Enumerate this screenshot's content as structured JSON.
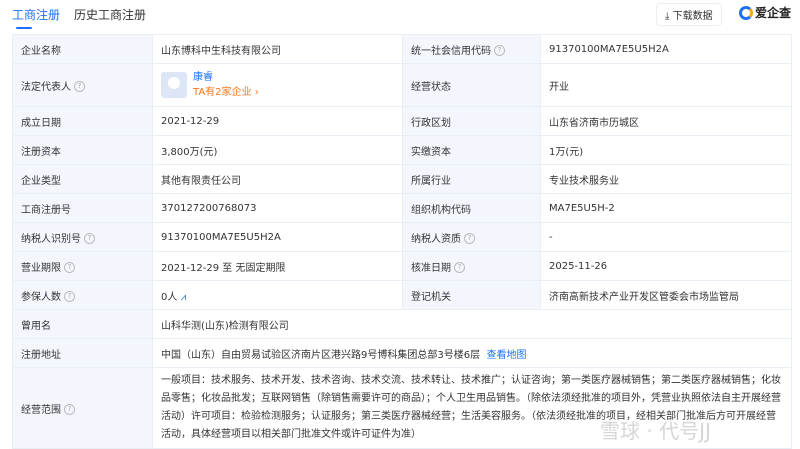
{
  "tabs": [
    "工商注册",
    "历史工商注册"
  ],
  "download": "下载数据",
  "logo": "爱企查",
  "watermark": "雪球 · 代号JJ",
  "rows": {
    "name_l": "企业名称",
    "name_v": "山东博科中生科技有限公司",
    "credit_l": "统一社会信用代码",
    "credit_v": "91370100MA7E5U5H2A",
    "rep_l": "法定代表人",
    "rep_name": "康睿",
    "rep_more": "TA有2家企业 ›",
    "status_l": "经营状态",
    "status_v": "开业",
    "est_l": "成立日期",
    "est_v": "2021-12-29",
    "region_l": "行政区划",
    "region_v": "山东省济南市历城区",
    "cap_l": "注册资本",
    "cap_v": "3,800万(元)",
    "paid_l": "实缴资本",
    "paid_v": "1万(元)",
    "type_l": "企业类型",
    "type_v": "其他有限责任公司",
    "ind_l": "所属行业",
    "ind_v": "专业技术服务业",
    "reg_l": "工商注册号",
    "reg_v": "370127200768073",
    "org_l": "组织机构代码",
    "org_v": "MA7E5U5H-2",
    "tax_l": "纳税人识别号",
    "tax_v": "91370100MA7E5U5H2A",
    "taxq_l": "纳税人资质",
    "taxq_v": "-",
    "term_l": "营业期限",
    "term_v": "2021-12-29 至 无固定期限",
    "appr_l": "核准日期",
    "appr_v": "2025-11-26",
    "ins_l": "参保人数",
    "ins_v": "0人",
    "auth_l": "登记机关",
    "auth_v": "济南高新技术产业开发区管委会市场监管局",
    "former_l": "曾用名",
    "former_v": "山科华测(山东)检测有限公司",
    "addr_l": "注册地址",
    "addr_v": "中国（山东）自由贸易试验区济南片区港兴路9号博科集团总部3号楼6层",
    "addr_link": "查看地图",
    "scope_l": "经营范围",
    "scope_v": "一般项目：技术服务、技术开发、技术咨询、技术交流、技术转让、技术推广；认证咨询；第一类医疗器械销售；第二类医疗器械销售；化妆品零售；化妆品批发；互联网销售（除销售需要许可的商品）；个人卫生用品销售。（除依法须经批准的项目外，凭营业执照依法自主开展经营活动）许可项目：检验检测服务；认证服务；第三类医疗器械经营；生活美容服务。（依法须经批准的项目，经相关部门批准后方可开展经营活动，具体经营项目以相关部门批准文件或许可证件为准）"
  }
}
